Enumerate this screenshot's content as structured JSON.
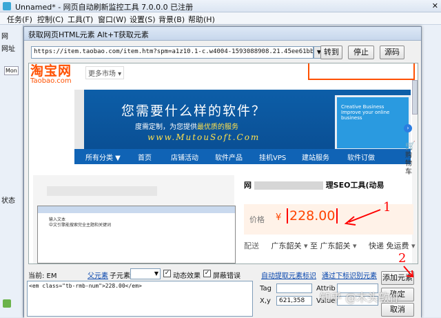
{
  "app": {
    "title": "Unnamed* - 网页自动刷新监控工具 7.0.0.0 已注册",
    "menu": [
      "任务(F)",
      "控制(C)",
      "工具(T)",
      "窗口(W)",
      "设置(S)",
      "背景(B)",
      "帮助(H)"
    ],
    "left_labels": [
      "网",
      "网址",
      "Mon",
      "状态"
    ]
  },
  "dialog": {
    "title": "获取网页HTML元素  Alt+T获取元素",
    "url": "https://item.taobao.com/item.htm?spm=a1z10.1-c.w4004-1593088908.21.45ee61bb0ZkEC8&id=88341",
    "buttons": {
      "go": "转到",
      "stop": "停止",
      "source": "源码"
    }
  },
  "web": {
    "logo_big": "淘宝网",
    "logo_small": "Taobao.com",
    "more_market": "更多市场",
    "banner": {
      "headline": "您需要什么样的软件？",
      "sub_prefix": "度需定制，为您提供",
      "sub_highlight": "最优质的服务",
      "url": "www.MutouSoft.Com",
      "screen_text": "Creative Business\nImprove your online\nbusiness"
    },
    "nav": [
      "所有分类 ▼",
      "首页",
      "店铺活动",
      "软件产品",
      "挂机VPS",
      "建站服务",
      "软件订做"
    ],
    "side_cart": [
      "购",
      "物",
      "车"
    ],
    "preview_lines": [
      "输入文本",
      "中文引擎能搜索完全主题和关键词"
    ],
    "product_title_pre": "网",
    "product_title_post": "理SEO工具(动易",
    "price_label": "价格",
    "currency": "¥",
    "price": "228.00",
    "delivery_label": "配送",
    "delivery_from": "广东韶关",
    "delivery_to_word": "至",
    "delivery_to": "广东韶关",
    "delivery_express": "快递 免运费"
  },
  "panel": {
    "current_label": "当前: EM",
    "parent_link": "父元素",
    "child_label": "子元素",
    "dynamic_label": "动态效果",
    "block_errors_label": "屏蔽错误",
    "auto_extract_link": "自动提取元素标识",
    "extract_by_link": "通过下标识别元素",
    "add_button": "添加元素",
    "confirm_button": "确定",
    "cancel_button": "取消",
    "code": "<em class=\"tb-rmb-num\">228.00</em>",
    "tag_label": "Tag",
    "attrib_label": "Attrib",
    "xy_label": "X,y",
    "xy_value": "621,358",
    "value_label": "Value"
  },
  "annotations": {
    "one": "1",
    "two": "2"
  },
  "watermark": "知乎 @木头软件"
}
